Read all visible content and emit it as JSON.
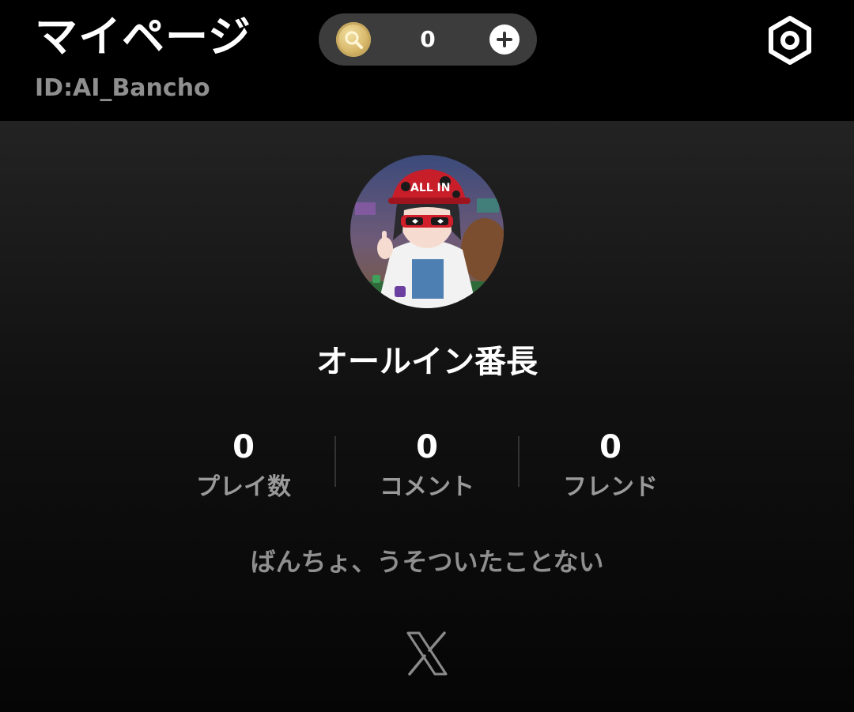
{
  "header": {
    "title": "マイページ",
    "user_id": "ID:AI_Bancho",
    "coin_count": "0",
    "icons": {
      "coin": "coin-icon",
      "add": "plus-icon",
      "settings": "settings-hexagon-icon"
    }
  },
  "profile": {
    "avatar": "avatar-image",
    "avatar_cap_text": "ALL IN",
    "display_name": "オールイン番長",
    "stats": [
      {
        "value": "0",
        "label": "プレイ数"
      },
      {
        "value": "0",
        "label": "コメント"
      },
      {
        "value": "0",
        "label": "フレンド"
      }
    ],
    "bio": "ばんちょ、うそついたことない",
    "social_icon": "x-logo-icon"
  },
  "colors": {
    "background": "#000000",
    "text_primary": "#ffffff",
    "text_secondary": "#8f8f8f",
    "pill_background": "#3c3c3c",
    "coin_gold": "#d8b86a"
  }
}
